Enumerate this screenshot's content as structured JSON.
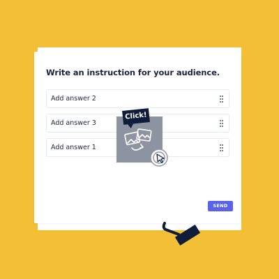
{
  "card": {
    "instruction": "Write an instruction for your audience.",
    "answers": [
      {
        "label": "Add answer 2"
      },
      {
        "label": "Add answer 3"
      },
      {
        "label": "Add answer 1"
      }
    ],
    "send_label": "SEND"
  },
  "overlay": {
    "badge_text": "Click!",
    "icon": "image-gallery-icon",
    "cursor_icon": "click-cursor-icon"
  },
  "decor": {
    "roller_icon": "paint-roller-icon"
  },
  "colors": {
    "background": "#F2BF37",
    "accent": "#5A62E8",
    "text": "#1D2240",
    "dark_navy": "#0F1C3A"
  }
}
